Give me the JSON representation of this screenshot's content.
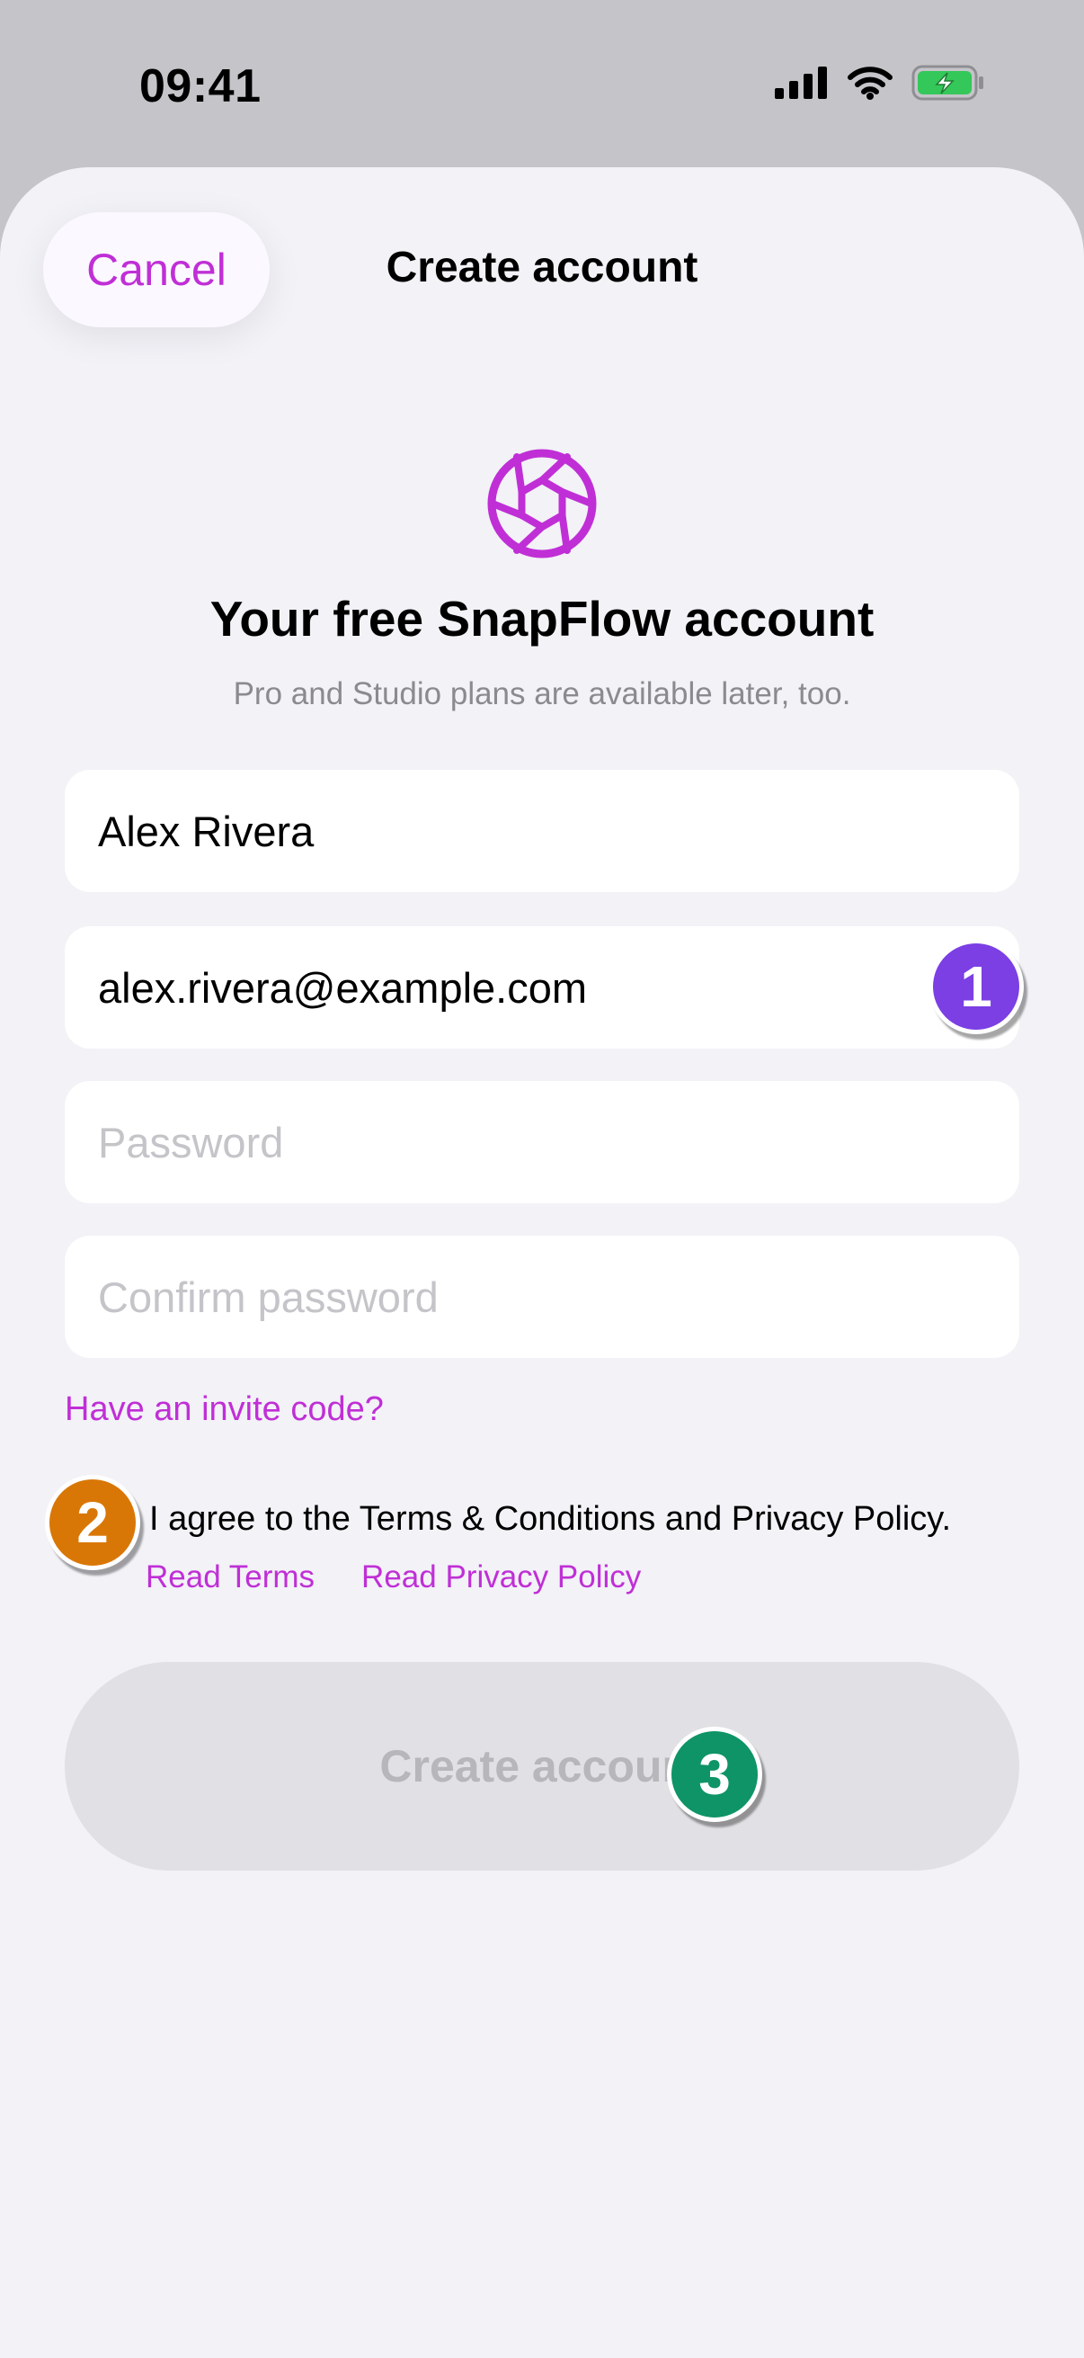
{
  "status_bar": {
    "time": "09:41"
  },
  "header": {
    "cancel_label": "Cancel",
    "title": "Create account"
  },
  "intro": {
    "headline": "Your free SnapFlow account",
    "subline": "Pro and Studio plans are available later, too."
  },
  "form": {
    "name_value": "Alex Rivera",
    "email_value": "alex.rivera@example.com",
    "password_placeholder": "Password",
    "confirm_placeholder": "Confirm password",
    "invite_link": "Have an invite code?",
    "terms_text": "I agree to the Terms & Conditions and Privacy Policy.",
    "read_terms": "Read Terms",
    "read_privacy": "Read Privacy Policy",
    "submit_label": "Create account"
  },
  "badges": [
    {
      "label": "1",
      "color": "#7b3fe4"
    },
    {
      "label": "2",
      "color": "#d97706"
    },
    {
      "label": "3",
      "color": "#0e9467"
    }
  ],
  "colors": {
    "accent": "#c02fd6",
    "battery_fill": "#34c759"
  }
}
